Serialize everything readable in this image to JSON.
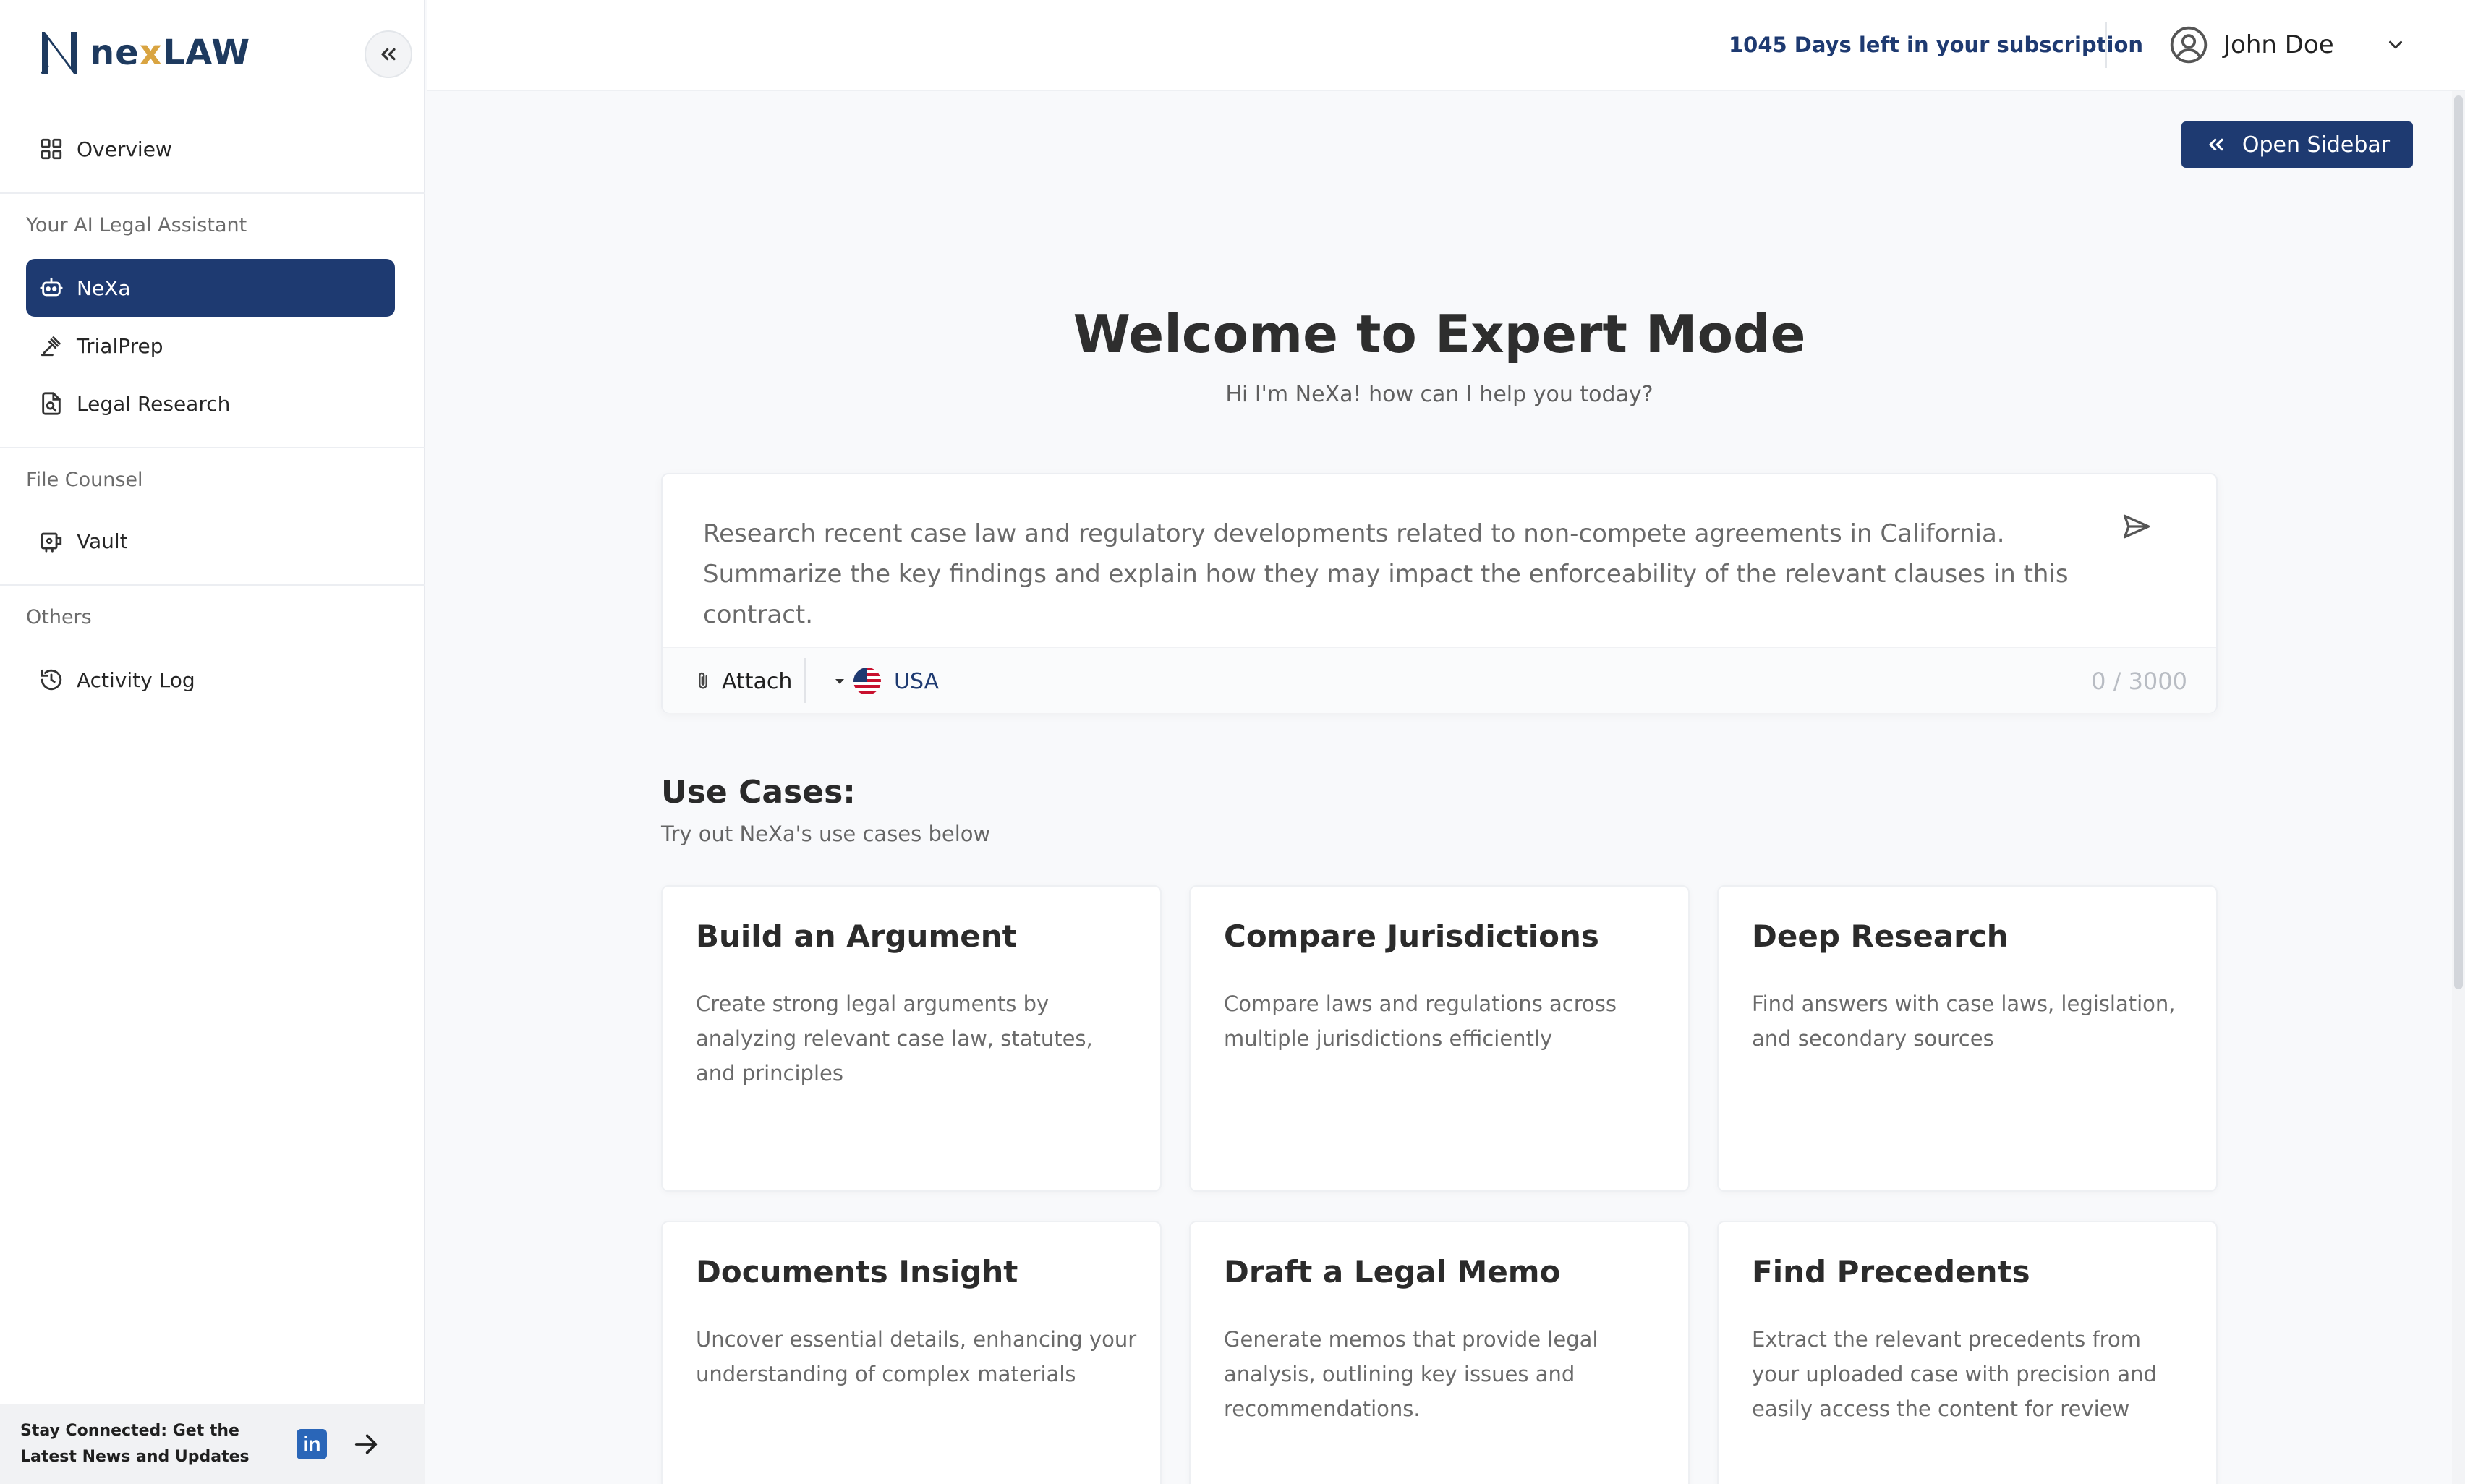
{
  "brand": {
    "name_pre": "ne",
    "name_x": "x",
    "name_post": "LAW"
  },
  "sidebar": {
    "overview": "Overview",
    "sections": [
      {
        "label": "Your AI Legal Assistant"
      },
      {
        "label": "File Counsel"
      },
      {
        "label": "Others"
      }
    ],
    "items": {
      "nexa": "NeXa",
      "trialprep": "TrialPrep",
      "legal_research": "Legal Research",
      "vault": "Vault",
      "activity_log": "Activity Log"
    },
    "footer_text": "Stay Connected: Get the Latest News and Updates",
    "linkedin_label": "in"
  },
  "header": {
    "subscription": "1045 Days left in your subscription",
    "user_name": "John Doe"
  },
  "main": {
    "open_sidebar": "Open Sidebar",
    "title": "Welcome to Expert Mode",
    "subtitle": "Hi I'm NeXa! how can I help you today?",
    "prompt": "Research recent case law and regulatory developments related to non-compete agreements in California. Summarize the key findings and explain how they may impact the enforceability of the relevant clauses in this contract.",
    "attach": "Attach",
    "country": "USA",
    "counter": "0 / 3000",
    "use_cases_title": "Use Cases:",
    "use_cases_sub": "Try out NeXa's use cases below",
    "cards": [
      {
        "title": "Build an Argument",
        "desc": "Create strong legal arguments by analyzing relevant case law, statutes, and principles"
      },
      {
        "title": "Compare Jurisdictions",
        "desc": "Compare laws and regulations across multiple jurisdictions efficiently"
      },
      {
        "title": "Deep Research",
        "desc": "Find answers with case laws, legislation, and secondary sources"
      },
      {
        "title": "Documents Insight",
        "desc": "Uncover essential details, enhancing your understanding of complex materials"
      },
      {
        "title": "Draft a Legal Memo",
        "desc": "Generate memos that provide legal analysis, outlining key issues and recommendations."
      },
      {
        "title": "Find Precedents",
        "desc": "Extract the relevant precedents from your uploaded case with precision and easily access the content for review"
      }
    ]
  },
  "colors": {
    "accent": "#1e3a71",
    "brand_x": "#d9a441"
  }
}
